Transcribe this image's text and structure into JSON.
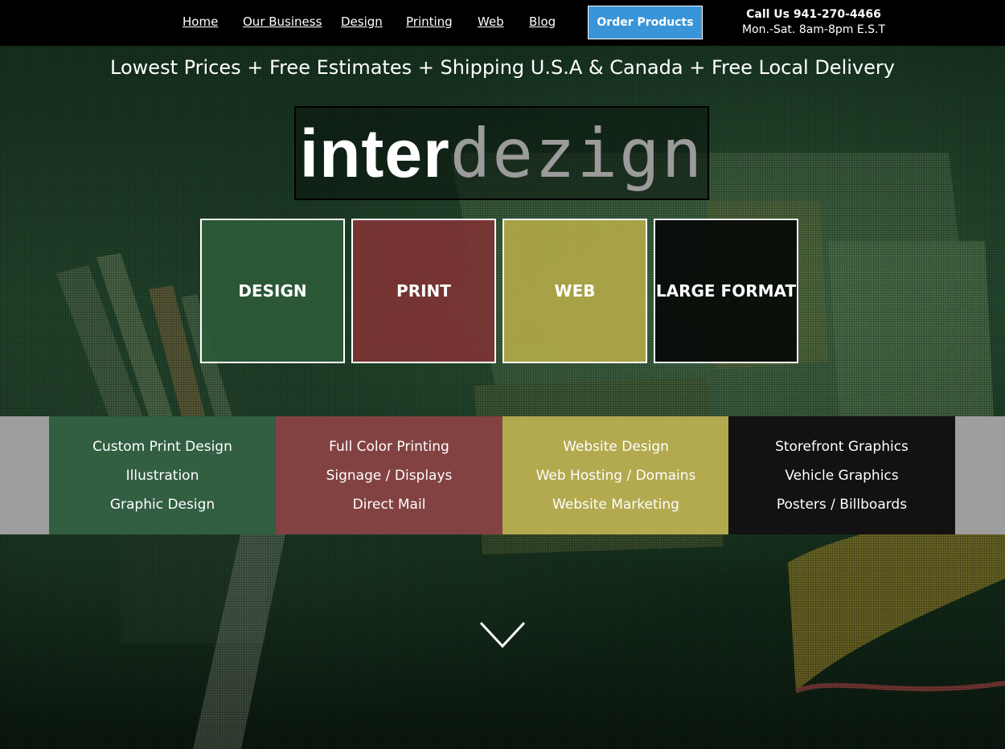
{
  "nav": {
    "items": [
      {
        "label": "Home"
      },
      {
        "label": "Our Business"
      },
      {
        "label": "Design"
      },
      {
        "label": "Printing"
      },
      {
        "label": "Web"
      },
      {
        "label": "Blog"
      }
    ],
    "order_button": "Order Products",
    "call_label": "Call Us 941-270-4466",
    "hours": "Mon.-Sat. 8am-8pm E.S.T"
  },
  "tagline": "Lowest Prices + Free Estimates + Shipping U.S.A & Canada + Free Local Delivery",
  "logo": {
    "part1": "inter",
    "part2": "dezign"
  },
  "tiles": [
    {
      "label": "DESIGN"
    },
    {
      "label": "PRINT"
    },
    {
      "label": "WEB"
    },
    {
      "label": "LARGE FORMAT"
    }
  ],
  "services": [
    {
      "items": [
        "Custom Print Design",
        "Illustration",
        "Graphic Design"
      ]
    },
    {
      "items": [
        "Full Color Printing",
        "Signage / Displays",
        "Direct Mail"
      ]
    },
    {
      "items": [
        "Website Design",
        "Web Hosting / Domains",
        "Website Marketing"
      ]
    },
    {
      "items": [
        "Storefront Graphics",
        "Vehicle Graphics",
        "Posters / Billboards"
      ]
    }
  ],
  "colors": {
    "design": "#325e42",
    "print": "#834242",
    "web": "#b3a94f",
    "large_format": "#121212",
    "order_button": "#3a95d8"
  },
  "icons": {
    "scroll_down": "chevron-down-icon"
  }
}
